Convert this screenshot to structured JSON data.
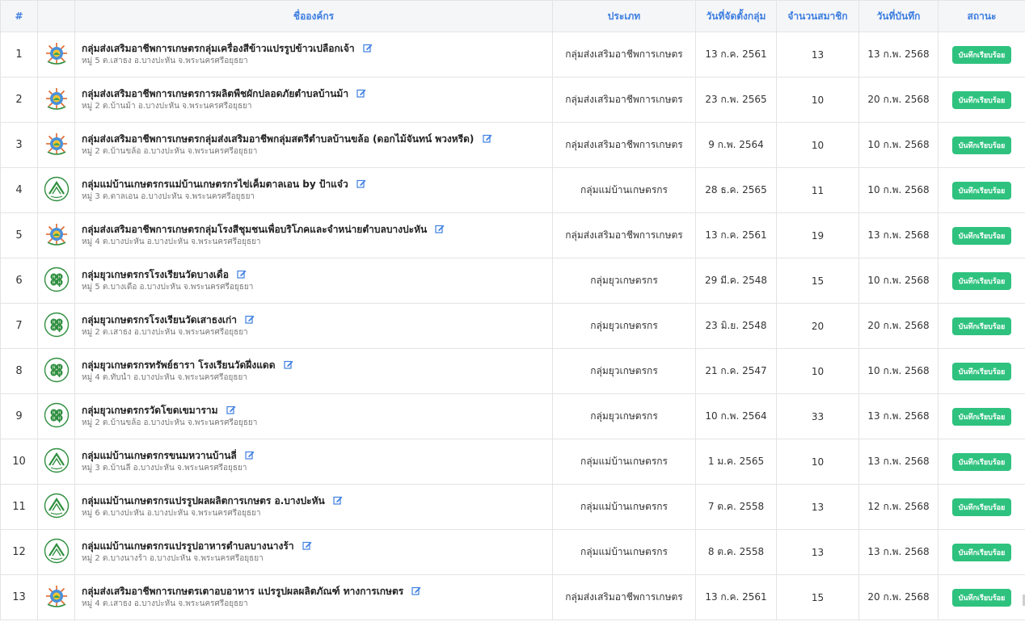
{
  "table": {
    "headers": {
      "num": "#",
      "logo": "",
      "name": "ชื่อองค์กร",
      "type": "ประเภท",
      "founded": "วันที่จัดตั้งกลุ่ม",
      "members": "จำนวนสมาชิก",
      "saved": "วันที่บันทึก",
      "status": "สถานะ"
    },
    "rows": [
      {
        "num": "1",
        "logo": "agri-promotion-logo",
        "name": "กลุ่มส่งเสริมอาชีพการเกษตรกลุ่มเครื่องสีข้าวแปรรูปข้าวเปลือกเจ้า",
        "address": "หมู่ 5 ต.เสาธง อ.บางปะหัน จ.พระนครศรีอยุธยา",
        "type": "กลุ่มส่งเสริมอาชีพการเกษตร",
        "founded": "13 ก.ค. 2561",
        "members": "13",
        "saved": "13 ก.พ. 2568",
        "status": "บันทึกเรียบร้อย"
      },
      {
        "num": "2",
        "logo": "agri-promotion-logo",
        "name": "กลุ่มส่งเสริมอาชีพการเกษตรการผลิตพืชผักปลอดภัยตำบลบ้านม้า",
        "address": "หมู่ 2 ต.บ้านม้า อ.บางปะหัน จ.พระนครศรีอยุธยา",
        "type": "กลุ่มส่งเสริมอาชีพการเกษตร",
        "founded": "23 ก.พ. 2565",
        "members": "10",
        "saved": "20 ก.พ. 2568",
        "status": "บันทึกเรียบร้อย"
      },
      {
        "num": "3",
        "logo": "agri-promotion-logo",
        "name": "กลุ่มส่งเสริมอาชีพการเกษตรกลุ่มส่งเสริมอาชีพกลุ่มสตรีตำบลบ้านขล้อ (ดอกไม้จันทน์ พวงหรีด)",
        "address": "หมู่ 2 ต.บ้านขล้อ อ.บางปะหัน จ.พระนครศรีอยุธยา",
        "type": "กลุ่มส่งเสริมอาชีพการเกษตร",
        "founded": "9 ก.พ. 2564",
        "members": "10",
        "saved": "10 ก.พ. 2568",
        "status": "บันทึกเรียบร้อย"
      },
      {
        "num": "4",
        "logo": "housewife-group-logo",
        "name": "กลุ่มแม่บ้านเกษตรกรแม่บ้านเกษตรกรไข่เค็มตาลเอน by ป้าแจ๋ว",
        "address": "หมู่ 3 ต.ตาลเอน อ.บางปะหัน จ.พระนครศรีอยุธยา",
        "type": "กลุ่มแม่บ้านเกษตรกร",
        "founded": "28 ธ.ค. 2565",
        "members": "11",
        "saved": "10 ก.พ. 2568",
        "status": "บันทึกเรียบร้อย"
      },
      {
        "num": "5",
        "logo": "agri-promotion-logo",
        "name": "กลุ่มส่งเสริมอาชีพการเกษตรกลุ่มโรงสีชุมชนเพื่อบริโภคและจำหน่ายตำบลบางปะหัน",
        "address": "หมู่ 4 ต.บางปะหัน อ.บางปะหัน จ.พระนครศรีอยุธยา",
        "type": "กลุ่มส่งเสริมอาชีพการเกษตร",
        "founded": "13 ก.ค. 2561",
        "members": "19",
        "saved": "13 ก.พ. 2568",
        "status": "บันทึกเรียบร้อย"
      },
      {
        "num": "6",
        "logo": "young-farmer-logo",
        "name": "กลุ่มยุวเกษตรกรโรงเรียนวัดบางเดื่อ",
        "address": "หมู่ 5 ต.บางเดื่อ อ.บางปะหัน จ.พระนครศรีอยุธยา",
        "type": "กลุ่มยุวเกษตรกร",
        "founded": "29 มี.ค. 2548",
        "members": "15",
        "saved": "10 ก.พ. 2568",
        "status": "บันทึกเรียบร้อย"
      },
      {
        "num": "7",
        "logo": "young-farmer-logo",
        "name": "กลุ่มยุวเกษตรกรโรงเรียนวัดเสาธงเก่า",
        "address": "หมู่ 2 ต.เสาธง อ.บางปะหัน จ.พระนครศรีอยุธยา",
        "type": "กลุ่มยุวเกษตรกร",
        "founded": "23 มิ.ย. 2548",
        "members": "20",
        "saved": "20 ก.พ. 2568",
        "status": "บันทึกเรียบร้อย"
      },
      {
        "num": "8",
        "logo": "young-farmer-logo",
        "name": "กลุ่มยุวเกษตรกรทรัพย์ธารา โรงเรียนวัดฝึ่งแดด",
        "address": "หมู่ 4 ต.ทับน้ำ อ.บางปะหัน จ.พระนครศรีอยุธยา",
        "type": "กลุ่มยุวเกษตรกร",
        "founded": "21 ก.ค. 2547",
        "members": "10",
        "saved": "10 ก.พ. 2568",
        "status": "บันทึกเรียบร้อย"
      },
      {
        "num": "9",
        "logo": "young-farmer-logo",
        "name": "กลุ่มยุวเกษตรกรวัดโขดเขมาราม",
        "address": "หมู่ 2 ต.บ้านขล้อ อ.บางปะหัน จ.พระนครศรีอยุธยา",
        "type": "กลุ่มยุวเกษตรกร",
        "founded": "10 ก.พ. 2564",
        "members": "33",
        "saved": "13 ก.พ. 2568",
        "status": "บันทึกเรียบร้อย"
      },
      {
        "num": "10",
        "logo": "housewife-group-logo",
        "name": "กลุ่มแม่บ้านเกษตรกรขนมหวานบ้านลี่",
        "address": "หมู่ 3 ต.บ้านลี่ อ.บางปะหัน จ.พระนครศรีอยุธยา",
        "type": "กลุ่มแม่บ้านเกษตรกร",
        "founded": "1 ม.ค. 2565",
        "members": "10",
        "saved": "13 ก.พ. 2568",
        "status": "บันทึกเรียบร้อย"
      },
      {
        "num": "11",
        "logo": "housewife-group-logo",
        "name": "กลุ่มแม่บ้านเกษตรกรแปรรูปผลผลิตการเกษตร อ.บางปะหัน",
        "address": "หมู่ 6 ต.บางปะหัน อ.บางปะหัน จ.พระนครศรีอยุธยา",
        "type": "กลุ่มแม่บ้านเกษตรกร",
        "founded": "7 ต.ค. 2558",
        "members": "13",
        "saved": "12 ก.พ. 2568",
        "status": "บันทึกเรียบร้อย"
      },
      {
        "num": "12",
        "logo": "housewife-group-logo",
        "name": "กลุ่มแม่บ้านเกษตรกรแปรรูปอาหารตำบลบางนางร้า",
        "address": "หมู่ 2 ต.บางนางร้า อ.บางปะหัน จ.พระนครศรีอยุธยา",
        "type": "กลุ่มแม่บ้านเกษตรกร",
        "founded": "8 ต.ค. 2558",
        "members": "13",
        "saved": "13 ก.พ. 2568",
        "status": "บันทึกเรียบร้อย"
      },
      {
        "num": "13",
        "logo": "agri-promotion-logo",
        "name": "กลุ่มส่งเสริมอาชีพการเกษตรเตาอบอาหาร แปรรูปผลผลิตภัณฑ์ ทางการเกษตร",
        "address": "หมู่ 4 ต.เสาธง อ.บางปะหัน จ.พระนครศรีอยุธยา",
        "type": "กลุ่มส่งเสริมอาชีพการเกษตร",
        "founded": "13 ก.ค. 2561",
        "members": "15",
        "saved": "20 ก.พ. 2568",
        "status": "บันทึกเรียบร้อย"
      }
    ]
  },
  "colors": {
    "header_text": "#3d7ee0",
    "header_bg": "#f5f6f8",
    "status_badge": "#2ec27e",
    "edit_icon": "#3d7ee0"
  },
  "icons": {
    "edit": "edit-icon"
  }
}
